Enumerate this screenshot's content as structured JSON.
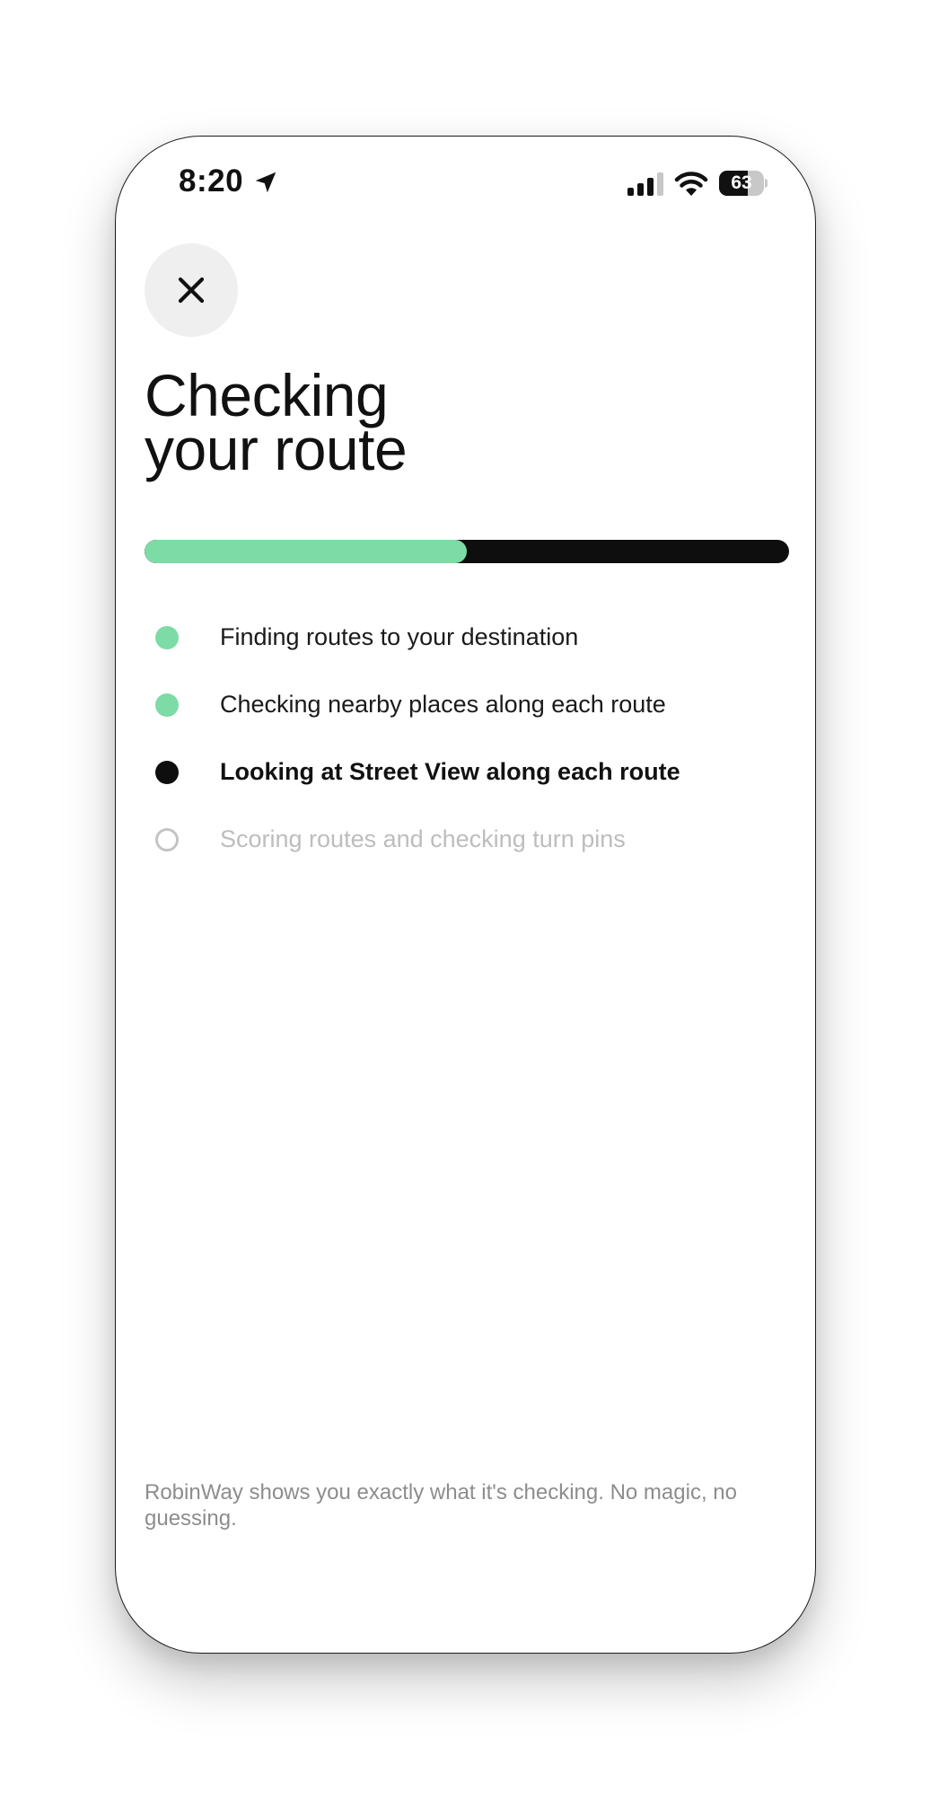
{
  "status_bar": {
    "time": "8:20",
    "battery_level": "63",
    "battery_fraction": 0.63,
    "icons": [
      "location-arrow-icon",
      "cellular-signal-icon",
      "wifi-icon",
      "battery-icon"
    ]
  },
  "header": {
    "close_icon": "close-icon",
    "title_line_1": "Checking",
    "title_line_2": "your route"
  },
  "progress": {
    "fraction": 0.5,
    "fill_color": "#7ddba6",
    "track_color": "#0e0e0e"
  },
  "steps": [
    {
      "label": "Finding routes to your destination",
      "state": "done"
    },
    {
      "label": "Checking nearby places along each route",
      "state": "done"
    },
    {
      "label": "Looking at Street View along each route",
      "state": "active"
    },
    {
      "label": "Scoring routes and checking turn pins",
      "state": "pending"
    }
  ],
  "footer": {
    "note": "RobinWay shows you exactly what it's checking. No magic, no guessing."
  },
  "colors": {
    "accent_green": "#7ddba6",
    "active_black": "#0e0e0e",
    "pending_gray": "#bdbdbd",
    "muted_text": "#8d8d8d"
  }
}
